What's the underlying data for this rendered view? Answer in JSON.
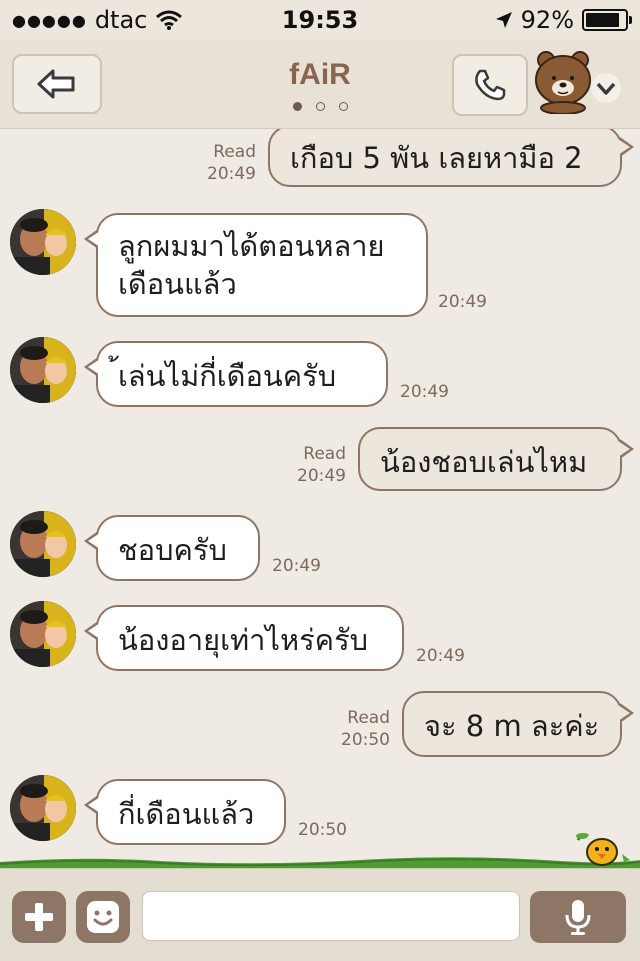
{
  "status_bar": {
    "carrier": "dtac",
    "time": "19:53",
    "battery": "92%",
    "battery_level": 0.92
  },
  "header": {
    "title": "fAiR",
    "page_count": 3,
    "active_page": 1
  },
  "messages": [
    {
      "direction": "out",
      "text": "เกือบ 5 พัน เลยหามือ 2",
      "read": "Read",
      "time": "20:49"
    },
    {
      "direction": "in",
      "lines": [
        "ลูกผมมาได้ตอนหลาย",
        "เดือนแล้ว"
      ],
      "time": "20:49"
    },
    {
      "direction": "in",
      "text": "้เล่นไม่กี่เดือนครับ",
      "time": "20:49"
    },
    {
      "direction": "out",
      "text": "น้องชอบเล่นไหม",
      "read": "Read",
      "time": "20:49"
    },
    {
      "direction": "in",
      "text": "ชอบครับ",
      "time": "20:49"
    },
    {
      "direction": "in",
      "text": "น้องอายุเท่าไหร่ครับ",
      "time": "20:49"
    },
    {
      "direction": "out",
      "text": "จะ 8 m ละค่ะ",
      "read": "Read",
      "time": "20:50"
    },
    {
      "direction": "in",
      "text": "กี่เดือนแล้ว",
      "time": "20:50"
    }
  ],
  "input": {
    "value": ""
  },
  "colors": {
    "background": "#efebe4",
    "bubble_border": "#8f7664",
    "title": "#8a6450",
    "button": "#8e7666"
  },
  "icons": {
    "back": "back-arrow-icon",
    "call": "phone-icon",
    "menu": "brown-bear-icon",
    "add": "plus-icon",
    "sticker": "smiley-icon",
    "mic": "microphone-icon"
  }
}
